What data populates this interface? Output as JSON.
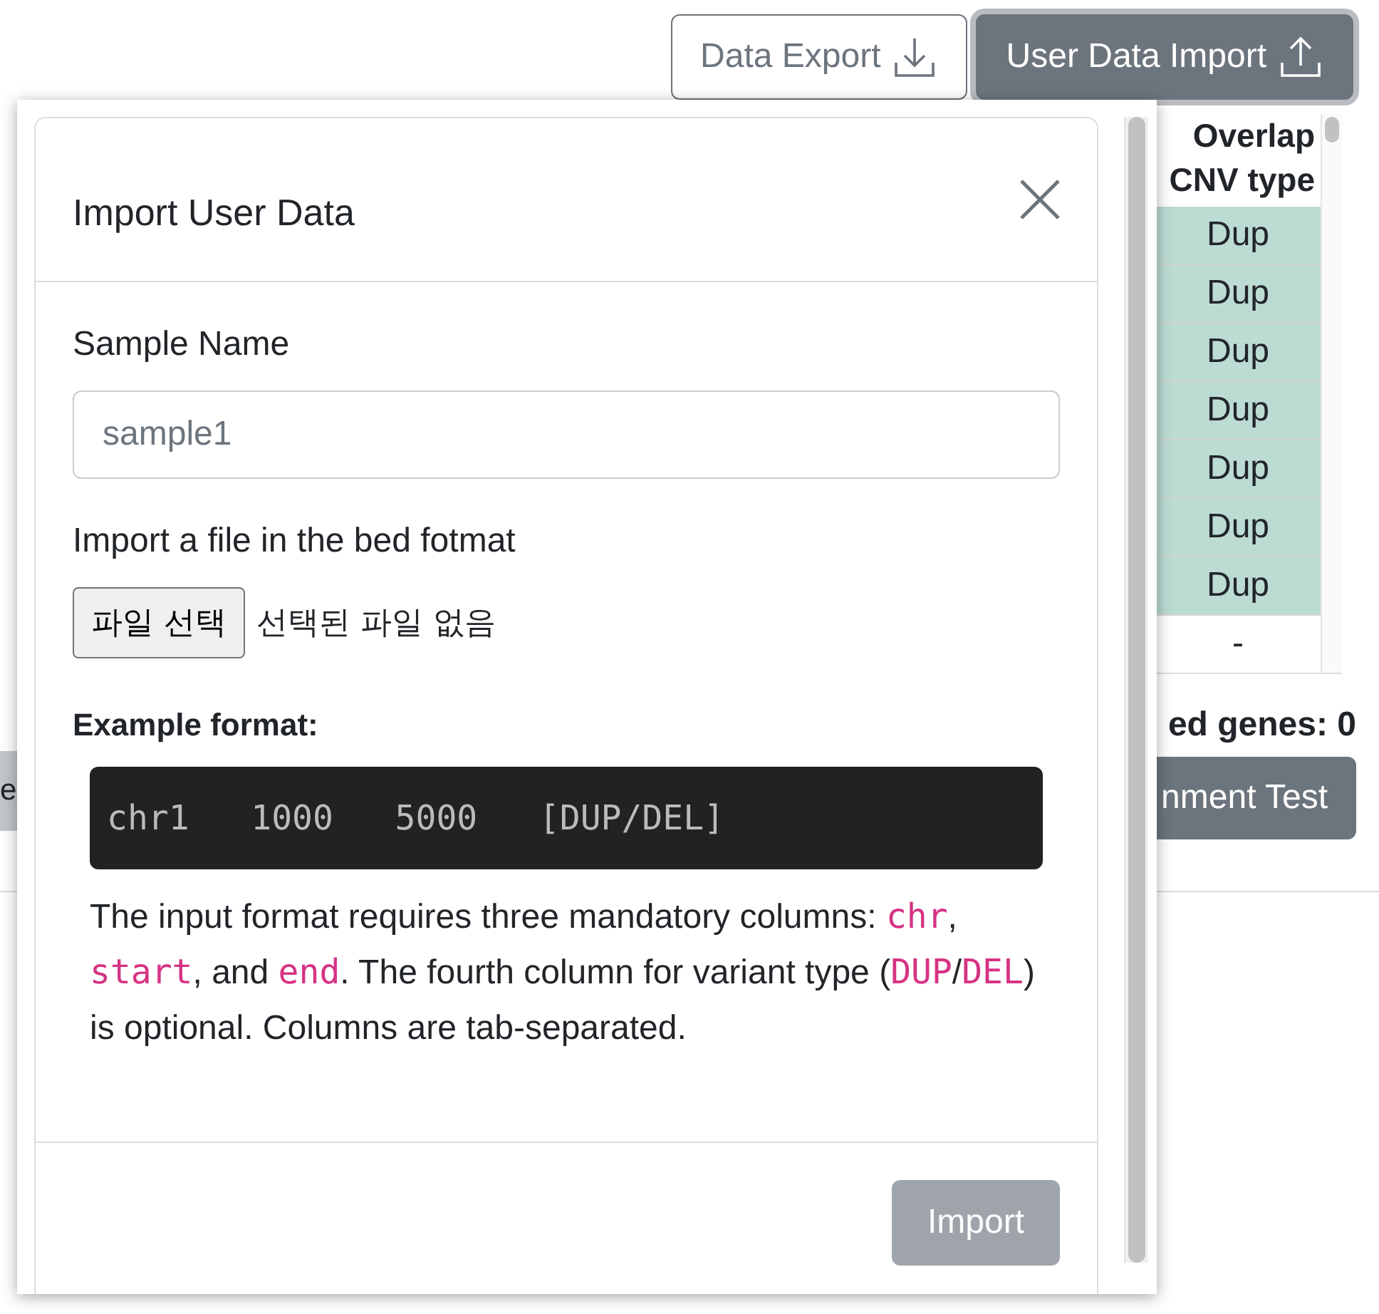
{
  "toolbar": {
    "buttons": [
      {
        "label": "Data Export",
        "kind": "export",
        "selected": false
      },
      {
        "label": "User Data Import",
        "kind": "import",
        "selected": true
      }
    ]
  },
  "background": {
    "left_fragments": [
      {
        "text": "e",
        "kind": "button"
      }
    ],
    "table": {
      "header": "Overlap CNV type",
      "rows": [
        "Dup",
        "Dup",
        "Dup",
        "Dup",
        "Dup",
        "Dup",
        "Dup",
        "-"
      ]
    },
    "summary": "ed genes: 0",
    "test_button": "nment Test"
  },
  "modal": {
    "title": "Import User Data",
    "sample_label": "Sample Name",
    "sample_placeholder": "sample1",
    "file_label": "Import a file in the bed fotmat",
    "file_button": "파일 선택",
    "file_status": "선택된 파일 없음",
    "example_heading": "Example format:",
    "example_code": "chr1   1000   5000   [DUP/DEL]",
    "description": [
      {
        "kind": "text",
        "text": "The input format requires three mandatory columns: "
      },
      {
        "kind": "code",
        "text": "chr"
      },
      {
        "kind": "text",
        "text": ", "
      },
      {
        "kind": "code",
        "text": "start"
      },
      {
        "kind": "text",
        "text": ", and "
      },
      {
        "kind": "code",
        "text": "end"
      },
      {
        "kind": "text",
        "text": ". The fourth column for variant type ("
      },
      {
        "kind": "code",
        "text": "DUP"
      },
      {
        "kind": "text",
        "text": "/"
      },
      {
        "kind": "code",
        "text": "DEL"
      },
      {
        "kind": "text",
        "text": ") is optional. Columns are tab-separated."
      }
    ],
    "import_button": {
      "label": "Import",
      "disabled": true
    }
  }
}
